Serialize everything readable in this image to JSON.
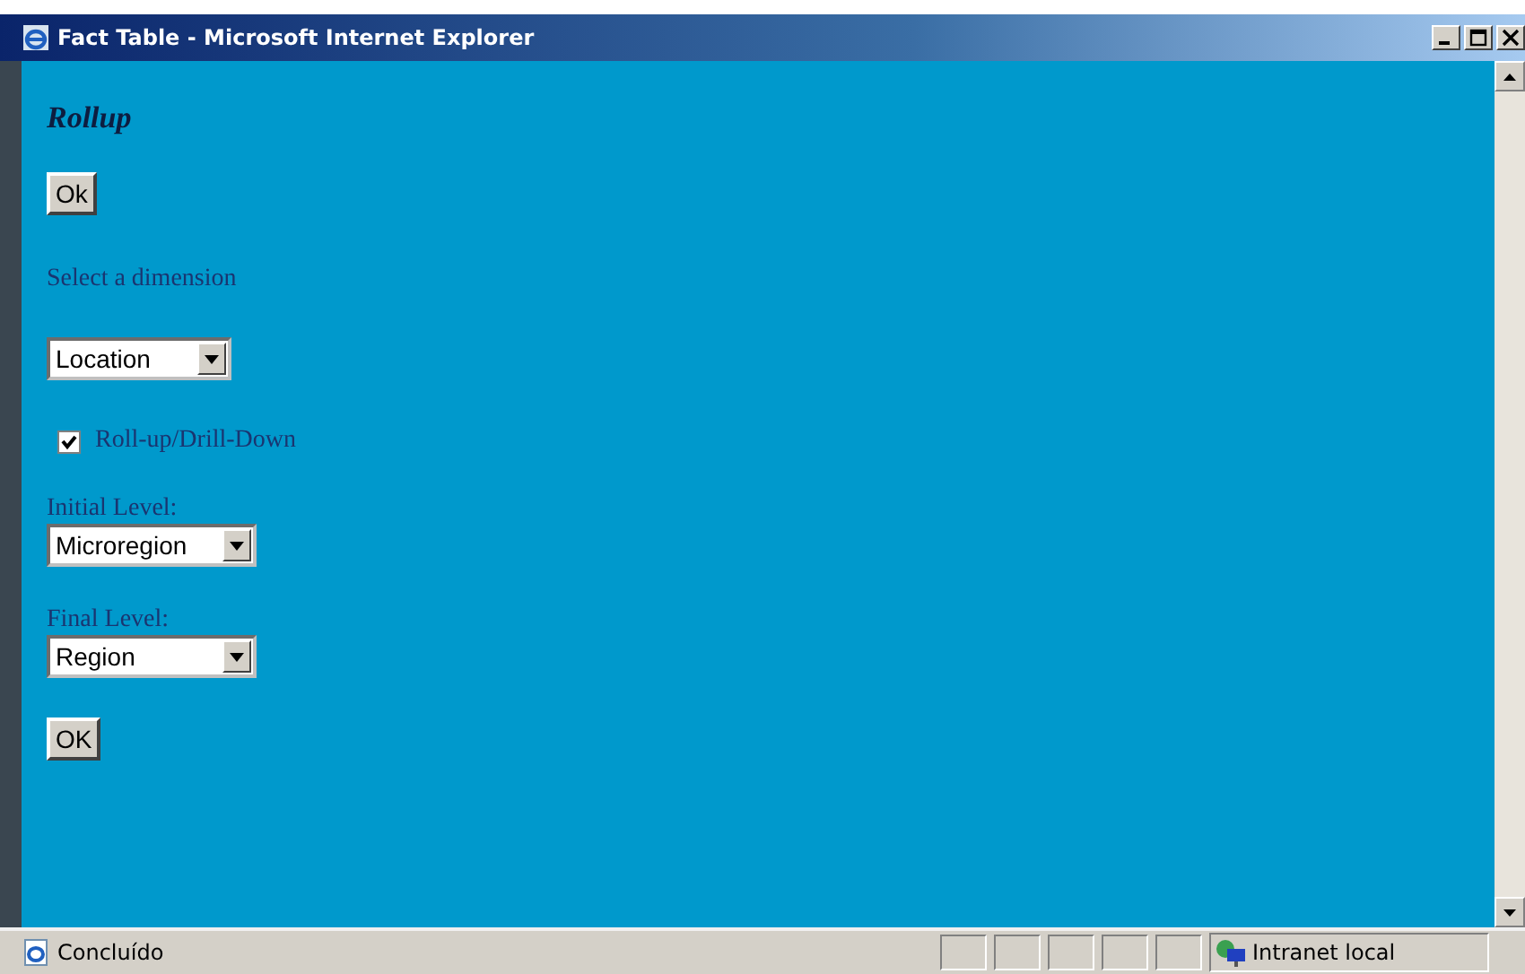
{
  "window": {
    "title": "Fact Table - Microsoft Internet Explorer"
  },
  "page": {
    "heading": "Rollup",
    "top_button": "Ok",
    "dimension_label": "Select a dimension",
    "dimension_select": {
      "value": "Location"
    },
    "rollup_checkbox": {
      "label": "Roll-up/Drill-Down",
      "checked": true
    },
    "levels": [
      {
        "label": "Initial Level:",
        "value": "Microregion"
      },
      {
        "label": "Final Level:",
        "value": "Region"
      }
    ],
    "bottom_button": "OK"
  },
  "status_bar": {
    "text": "Concluído",
    "zone": "Intranet local"
  }
}
